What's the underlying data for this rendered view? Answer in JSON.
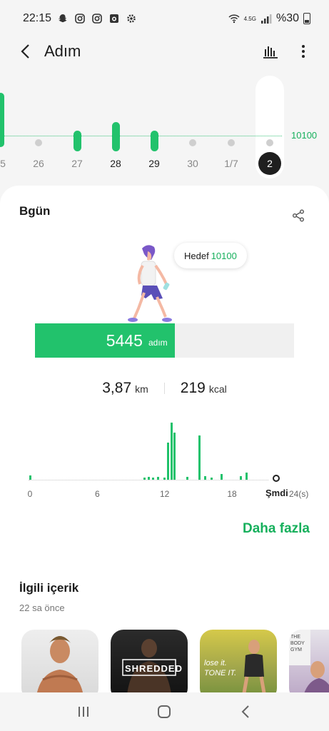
{
  "status": {
    "time": "22:15",
    "network": "4.5G",
    "battery": "%30",
    "icons": [
      "snapchat-icon",
      "instagram-icon",
      "instagram-icon",
      "camera-app-icon",
      "settings-icon"
    ]
  },
  "header": {
    "title": "Adım",
    "back_icon": "back-arrow-icon",
    "chart_icon": "bar-chart-icon",
    "more_icon": "more-vertical-icon"
  },
  "week_chart": {
    "goal_label": "10100",
    "days": [
      {
        "label": "5",
        "value": 10100,
        "state": "bar"
      },
      {
        "label": "26",
        "value": 0,
        "state": "dot"
      },
      {
        "label": "27",
        "value": 1500,
        "state": "bar"
      },
      {
        "label": "28",
        "value": 2800,
        "state": "bar"
      },
      {
        "label": "29",
        "value": 1500,
        "state": "bar"
      },
      {
        "label": "30",
        "value": 0,
        "state": "dot"
      },
      {
        "label": "1/7",
        "value": 0,
        "state": "dot"
      },
      {
        "label": "2",
        "value": 0,
        "state": "selected"
      }
    ]
  },
  "today": {
    "label": "Bgün",
    "goal_prefix": "Hedef",
    "goal_value": "10100",
    "steps": "5445",
    "steps_unit": "adım",
    "progress_fraction": 0.539,
    "distance": "3,87",
    "distance_unit": "km",
    "calories": "219",
    "calories_unit": "kcal"
  },
  "hour_chart": {
    "ticks": [
      "0",
      "6",
      "12",
      "18"
    ],
    "now_label": "Şmdi",
    "end_label": "24(s)",
    "bars": [
      {
        "h": 0.0,
        "v": 0.08
      },
      {
        "h": 10.2,
        "v": 0.04
      },
      {
        "h": 10.6,
        "v": 0.05
      },
      {
        "h": 11.0,
        "v": 0.04
      },
      {
        "h": 11.4,
        "v": 0.05
      },
      {
        "h": 12.0,
        "v": 0.04
      },
      {
        "h": 12.3,
        "v": 0.65
      },
      {
        "h": 12.6,
        "v": 1.0
      },
      {
        "h": 12.9,
        "v": 0.82
      },
      {
        "h": 14.0,
        "v": 0.05
      },
      {
        "h": 15.1,
        "v": 0.78
      },
      {
        "h": 15.6,
        "v": 0.06
      },
      {
        "h": 16.2,
        "v": 0.04
      },
      {
        "h": 17.1,
        "v": 0.1
      },
      {
        "h": 18.8,
        "v": 0.06
      },
      {
        "h": 19.3,
        "v": 0.12
      }
    ]
  },
  "more_link": "Daha fazla",
  "related": {
    "title": "İlgili içerik",
    "time": "22 sa önce",
    "thumbs": [
      {
        "text": ""
      },
      {
        "text": "SHREDDED"
      },
      {
        "text": "lose it. TONE IT."
      },
      {
        "text": "THE BODY GYM"
      }
    ]
  },
  "navbar": {
    "recents_icon": "recents-icon",
    "home_icon": "home-icon",
    "back_icon": "nav-back-icon"
  }
}
